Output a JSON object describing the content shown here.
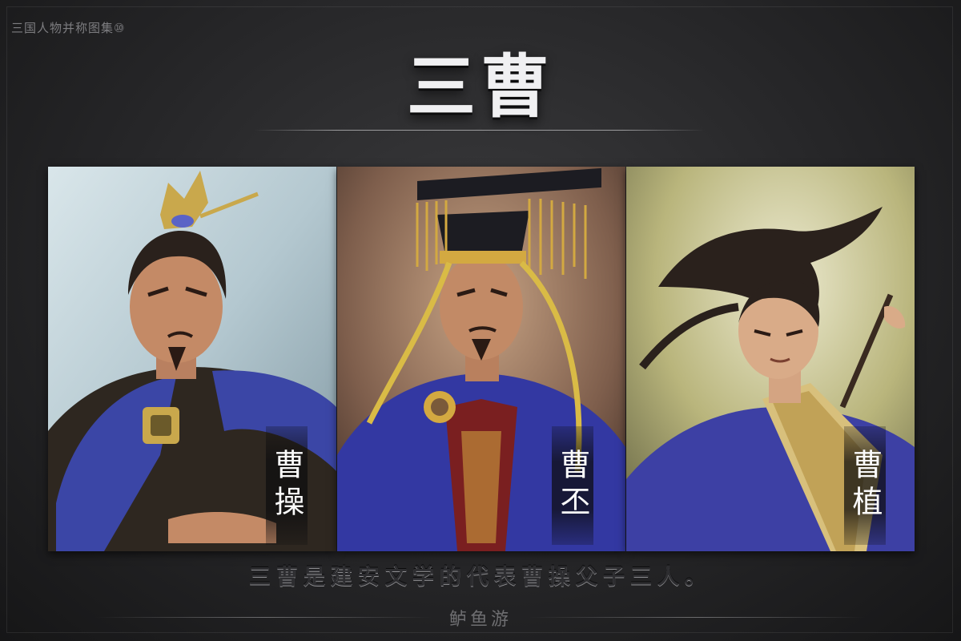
{
  "series_label": "三国人物并称图集⑩",
  "title": "三曹",
  "panels": [
    {
      "name": "曹操",
      "colors": {
        "bg": "#b9cbd3",
        "robe": "#3b46a6",
        "armor": "#3a3026",
        "gold": "#c9a84c"
      }
    },
    {
      "name": "曹丕",
      "colors": {
        "bg": "#8a6a56",
        "robe": "#3338a2",
        "armor": "#7a1f20",
        "gold": "#d3a941"
      }
    },
    {
      "name": "曹植",
      "colors": {
        "bg": "#c8c58c",
        "robe": "#3d40a4",
        "armor": "#d8c07c",
        "gold": "#d2b663"
      }
    }
  ],
  "caption": "三曹是建安文学的代表曹操父子三人。",
  "footer": "鲈鱼游"
}
